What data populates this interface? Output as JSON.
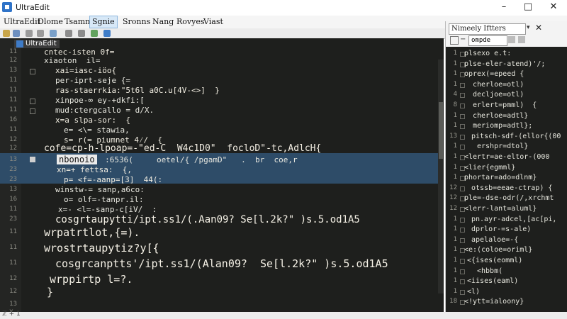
{
  "window": {
    "title": "UltraEdit",
    "minimize": "–",
    "maximize": "□",
    "close": "✕"
  },
  "menu": [
    "UltraEdit",
    "Dlome",
    "Tsamna",
    "Sgnie",
    "Sronns",
    "Nang",
    "Rovyes",
    "Viast"
  ],
  "editor": {
    "tab_label": "UltraEdit",
    "highlighted_word": "nbonoio",
    "lines": [
      {
        "n": "11",
        "text": "cntec-isten 0f=",
        "x": 62,
        "size": 11,
        "color": "#f0ece0"
      },
      {
        "n": "12",
        "text": "xiaoton  il=",
        "x": 62,
        "size": 11,
        "color": "#e8e8e0"
      },
      {
        "n": "13",
        "text": "xai=iasc-iöo{",
        "x": 78,
        "size": 11,
        "color": "#f0ece0"
      },
      {
        "n": "11",
        "text": "per-iprt-seje {=",
        "x": 78,
        "size": 11,
        "color": "#e8e8e0"
      },
      {
        "n": "11",
        "text": "ras-staerrkia:\"5t6l a0C.u[4V-<>]  }",
        "x": 78,
        "size": 11,
        "color": "#f0ece0"
      },
      {
        "n": "11",
        "text": "xinpoe-∞ ey-+dkfi:[",
        "x": 78,
        "size": 11,
        "color": "#e8e8e0"
      },
      {
        "n": "11",
        "text": "mud:ctergcallo = d/X.",
        "x": 78,
        "size": 11,
        "color": "#e8e8e0"
      },
      {
        "n": "16",
        "text": "x=a slpa-sor:  {",
        "x": 78,
        "size": 11,
        "color": "#f0ece0"
      },
      {
        "n": "11",
        "text": "e= <\\= stawia,",
        "x": 90,
        "size": 11,
        "color": "#e8e8e0"
      },
      {
        "n": "12",
        "text": "s= r(= piumnet 4⁄/  {",
        "x": 90,
        "size": 11,
        "color": "#f0ece0"
      },
      {
        "n": "12",
        "text": "cofe=cp-h-lpoap=-\"ed-C  W4c1D0\"  focloD\"-tc,AdlcH{",
        "x": 62,
        "size": 13,
        "color": "#f2ede2"
      },
      {
        "n": "13",
        "text": "             :6536(     oetel/{ /pgamD\"   .  br  coe,r",
        "x": 62,
        "size": 11,
        "color": "#e8e8e0"
      },
      {
        "n": "23",
        "text": "xn=+ fettsa:  {,",
        "x": 80,
        "size": 11,
        "color": "#f0ece0"
      },
      {
        "n": "23",
        "text": "p= <f=-aanp=[3]  44(:",
        "x": 90,
        "size": 11,
        "color": "#f0ece0"
      },
      {
        "n": "13",
        "text": "winstw-= sanp,a6co:",
        "x": 78,
        "size": 11,
        "color": "#e8e8e0"
      },
      {
        "n": "16",
        "text": "o= olf=-tanpr.il:",
        "x": 90,
        "size": 11,
        "color": "#e8e8e0"
      },
      {
        "n": "11",
        "text": "x=- <l=-sanp-c[iV/  :",
        "x": 82,
        "size": 11,
        "color": "#e8e8e0"
      },
      {
        "n": "23",
        "text": "cosgrtaupytti/ipt.ss1/(.Aan09? Se[l.2k?\" )s.5.od1A5",
        "x": 78,
        "size": 14,
        "color": "#f5f1e6"
      },
      {
        "n": "11",
        "text": "wrpatrtlot,{=).",
        "x": 62,
        "size": 15,
        "color": "#f5f1e6"
      },
      {
        "n": "11",
        "text": "wrostrtaupytiz?y[{",
        "x": 62,
        "size": 15,
        "color": "#f5f1e6"
      },
      {
        "n": "11",
        "text": "cosgrcanptts'/ipt.ss1/(Alan09?  Se[l.2k?\" )s.5.od1A5",
        "x": 78,
        "size": 15,
        "color": "#f5f1e6"
      },
      {
        "n": "12",
        "text": "wrppirtp l=?.",
        "x": 70,
        "size": 15,
        "color": "#f5f1e6"
      },
      {
        "n": "12",
        "text": "}",
        "x": 66,
        "size": 15,
        "color": "#f5f1e6"
      },
      {
        "n": "13",
        "text": "",
        "x": 62,
        "size": 11,
        "color": "#e8e8e0"
      },
      {
        "n": "X-",
        "text": "",
        "x": 62,
        "size": 11,
        "color": "#e8e8e0"
      }
    ]
  },
  "panel": {
    "title": "Nimeely Iftters",
    "dropdown": "▾",
    "close": "✕",
    "filter_value": "ompde",
    "lines": [
      {
        "n": "1",
        "text": "plsexo e.t:",
        "x": 26
      },
      {
        "n": "1",
        "text": "plse-eler-atend)'/;",
        "x": 26
      },
      {
        "n": "1",
        "text": "oprex(=epeed {",
        "x": 26
      },
      {
        "n": "1",
        "text": "cherloe=otl)",
        "x": 38
      },
      {
        "n": "4",
        "text": "decljoe=otl)",
        "x": 38
      },
      {
        "n": "8",
        "text": "erlert=pmml)  {",
        "x": 38
      },
      {
        "n": "1",
        "text": "cherloe=adtl}",
        "x": 38
      },
      {
        "n": "1",
        "text": "meriomp=adtl};",
        "x": 38
      },
      {
        "n": "13",
        "text": "pitsch-sdf-(ellor{(00",
        "x": 36
      },
      {
        "n": "1",
        "text": "ershpr=dtol}",
        "x": 44
      },
      {
        "n": "1",
        "text": "<lertr=ae-eltor-(000",
        "x": 26
      },
      {
        "n": "1",
        "text": "<lier{egmml}",
        "x": 26
      },
      {
        "n": "1",
        "text": "phortar=ado=dlnm}",
        "x": 26
      },
      {
        "n": "12",
        "text": "otssb=eeae-ctrap) {",
        "x": 36
      },
      {
        "n": "12",
        "text": "ple=-dse-odr(/,xrchmt",
        "x": 26
      },
      {
        "n": "12",
        "text": "<lerr-lant=aluml}",
        "x": 26
      },
      {
        "n": "1",
        "text": "pn.ayr-adcel,[ac[pi,",
        "x": 36
      },
      {
        "n": "1",
        "text": "dprlor-=s-ale)",
        "x": 36
      },
      {
        "n": "1",
        "text": "apelaloe=-{",
        "x": 36
      },
      {
        "n": "1",
        "text": "<e:(coloe=oriml}",
        "x": 26
      },
      {
        "n": "1",
        "text": "<{ises(eomml)",
        "x": 30
      },
      {
        "n": "1",
        "text": "<hbbm(",
        "x": 44
      },
      {
        "n": "1",
        "text": "<iises(eaml)",
        "x": 30
      },
      {
        "n": "1",
        "text": "<l)",
        "x": 30
      },
      {
        "n": "18",
        "text": "<!ytt=ialoony}",
        "x": 26
      }
    ]
  },
  "status": {
    "text": "ℤ +  1"
  }
}
